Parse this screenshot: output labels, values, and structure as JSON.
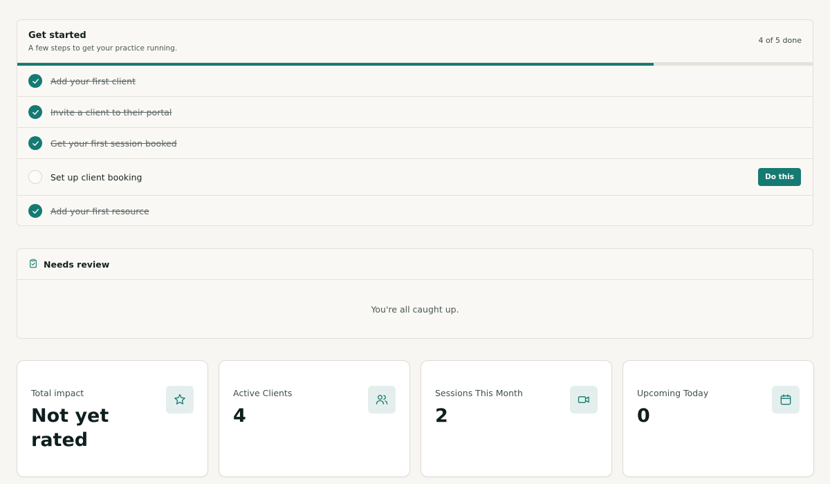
{
  "get_started": {
    "title": "Get started",
    "subtitle": "A few steps to get your practice running.",
    "count_label": "4 of 5 done",
    "progress": 0.8,
    "tasks": [
      {
        "label": "Add your first client",
        "done": true
      },
      {
        "label": "Invite a client to their portal",
        "done": true
      },
      {
        "label": "Get your first session booked",
        "done": true
      },
      {
        "label": "Set up client booking",
        "done": false,
        "action_label": "Do this"
      },
      {
        "label": "Add your first resource",
        "done": true
      }
    ]
  },
  "needs_review": {
    "title": "Needs review",
    "empty_message": "You're all caught up.",
    "icon": "clipboard-check-icon"
  },
  "stats": [
    {
      "label": "Total impact",
      "value": "Not yet rated",
      "icon": "star-icon"
    },
    {
      "label": "Active Clients",
      "value": "4",
      "icon": "users-icon"
    },
    {
      "label": "Sessions This Month",
      "value": "2",
      "icon": "video-icon"
    },
    {
      "label": "Upcoming Today",
      "value": "0",
      "icon": "calendar-icon"
    }
  ],
  "colors": {
    "accent": "#157a72",
    "background": "#f8f6f2",
    "icon_tile": "#e4efed"
  }
}
